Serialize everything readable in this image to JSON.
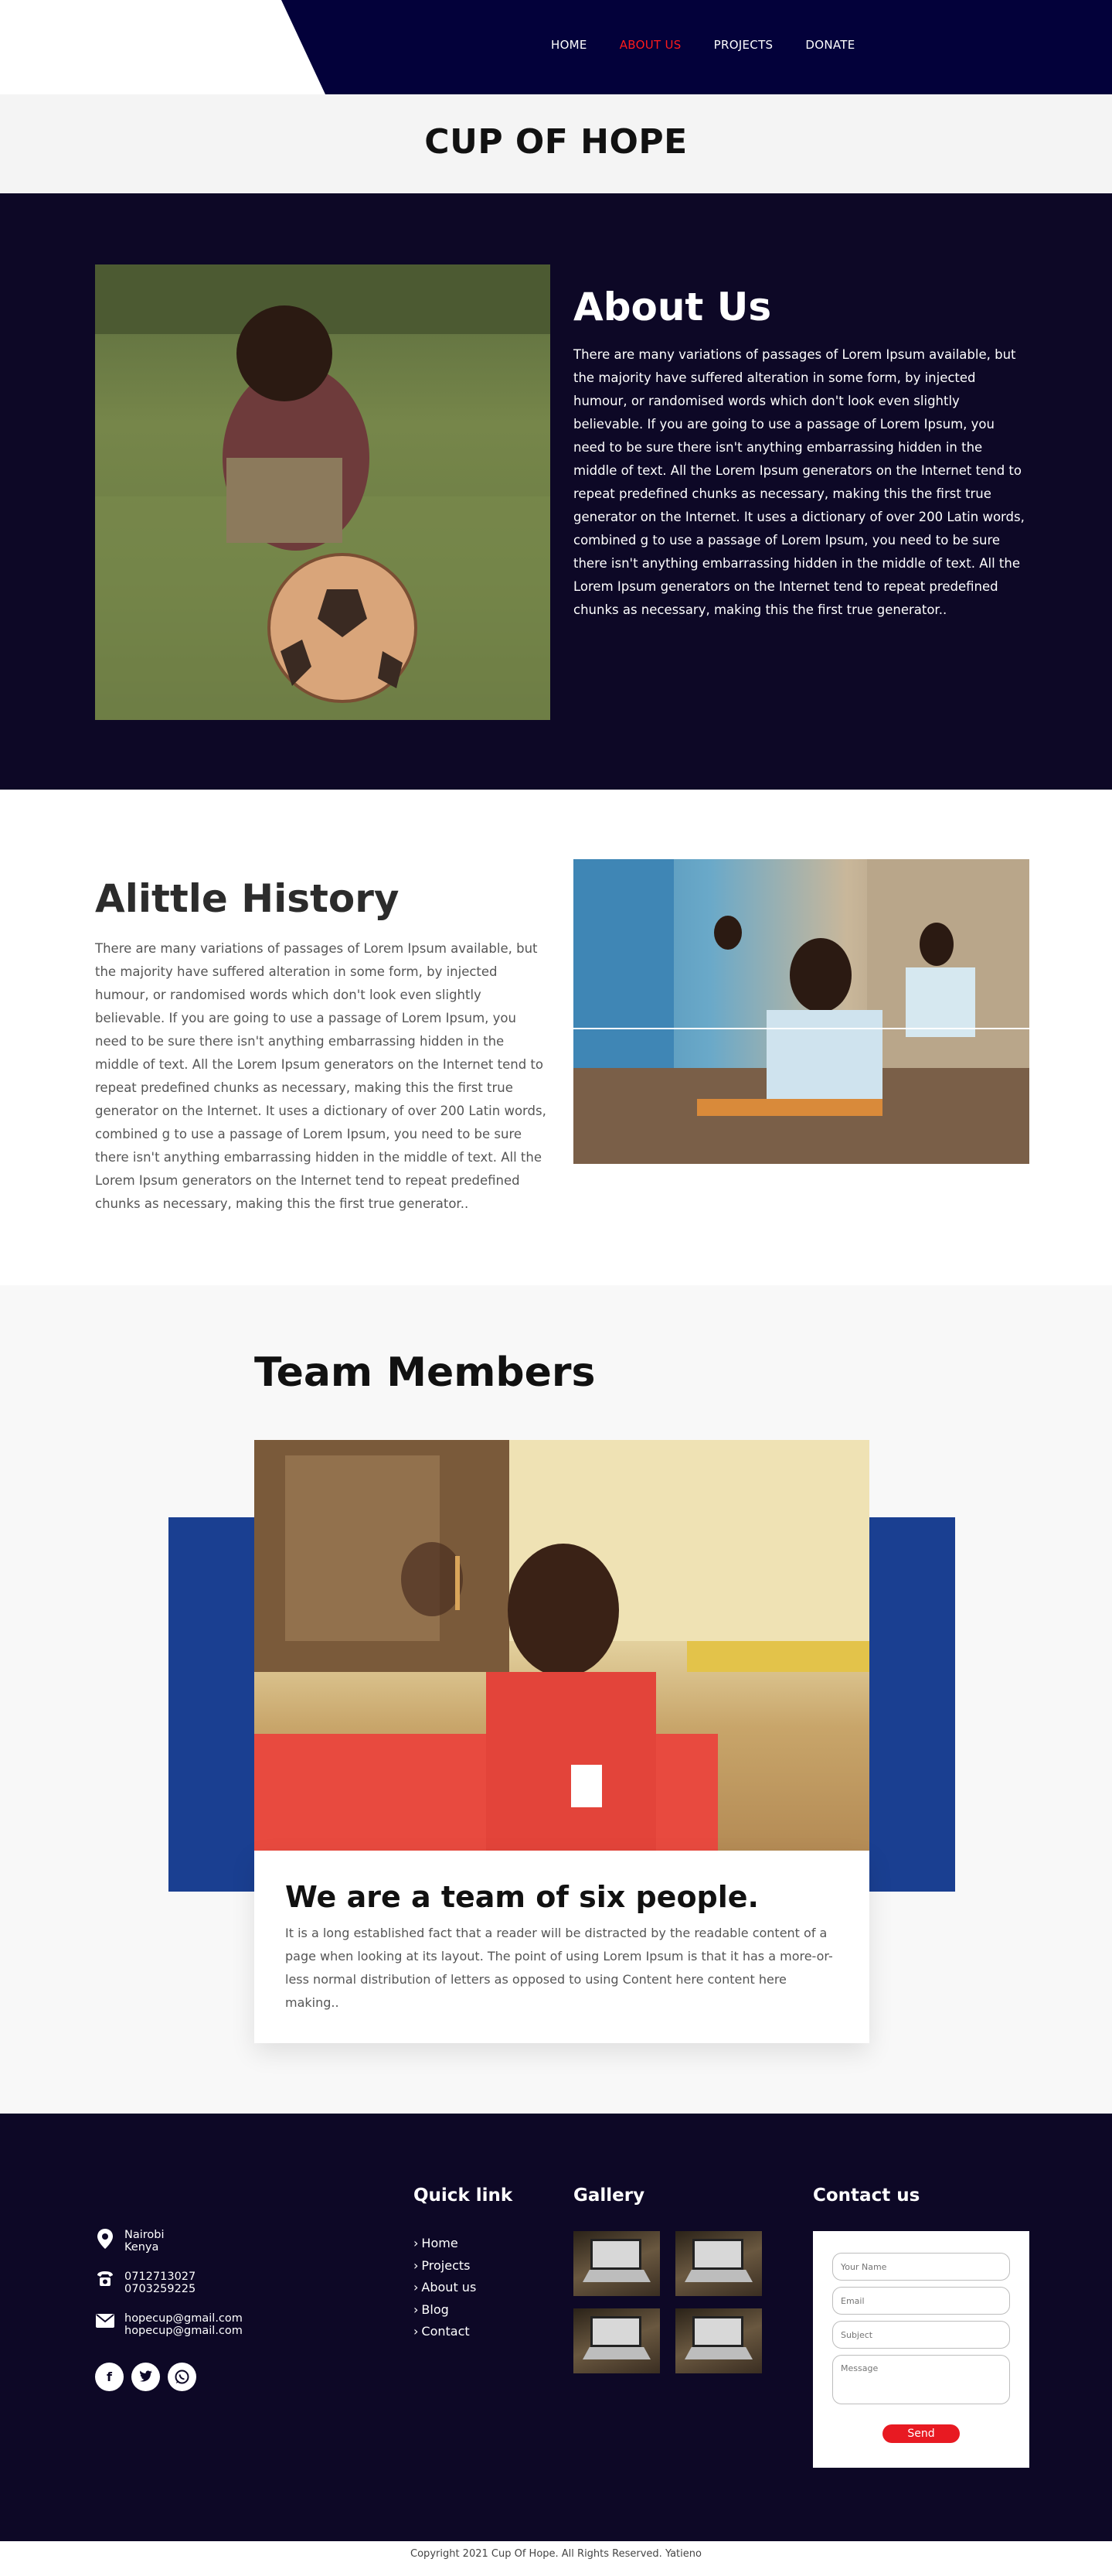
{
  "header": {
    "nav": [
      {
        "label": "HOME",
        "active": false
      },
      {
        "label": "ABOUT US",
        "active": true
      },
      {
        "label": "PROJECTS",
        "active": false
      },
      {
        "label": "DONATE",
        "active": false
      }
    ],
    "site_title": "CUP OF HOPE"
  },
  "about": {
    "title": "About Us",
    "text": "There are many variations of passages of Lorem Ipsum available, but the majority have suffered alteration in some form, by injected humour, or randomised words which don't look even slightly believable. If you are going to use a passage of Lorem Ipsum, you need to be sure there isn't anything embarrassing hidden in the middle of text. All the Lorem Ipsum generators on the Internet tend to repeat predefined chunks as necessary, making this the first true generator on the Internet. It uses a dictionary of over 200 Latin words, combined g to use a passage of Lorem Ipsum, you need to be sure there isn't anything embarrassing hidden in the middle of text. All the Lorem Ipsum generators on the Internet tend to repeat predefined chunks as necessary, making this the first true generator.."
  },
  "history": {
    "title": "Alittle History",
    "text": "There are many variations of passages of Lorem Ipsum available, but the majority have suffered alteration in some form, by injected humour, or randomised words which don't look even slightly believable. If you are going to use a passage of Lorem Ipsum, you need to be sure there isn't anything embarrassing hidden in the middle of text. All the Lorem Ipsum generators on the Internet tend to repeat predefined chunks as necessary, making this the first true generator on the Internet. It uses a dictionary of over 200 Latin words, combined g to use a passage of Lorem Ipsum, you need to be sure there isn't anything embarrassing hidden in the middle of text. All the Lorem Ipsum generators on the Internet tend to repeat predefined chunks as necessary, making this the first true generator.."
  },
  "team": {
    "title": "Team Members",
    "card_title": "We are a team of six people.",
    "card_text": "It is a long established fact that a reader will be distracted by the readable content of a page when looking at its layout. The point of using Lorem Ipsum is that it has a more-or-less normal distribution of letters as opposed to using Content here content here making.."
  },
  "footer": {
    "location": {
      "line1": "Nairobi",
      "line2": "Kenya",
      "icon": "map-pin-icon"
    },
    "phone": {
      "line1": "0712713027",
      "line2": "0703259225",
      "icon": "phone-icon"
    },
    "email": {
      "line1": "hopecup@gmail.com",
      "line2": "hopecup@gmail.com",
      "icon": "envelope-icon"
    },
    "socials": [
      {
        "name": "facebook-icon",
        "glyph": "f"
      },
      {
        "name": "twitter-icon",
        "glyph": "t"
      },
      {
        "name": "whatsapp-icon",
        "glyph": "w"
      }
    ],
    "quick_link_title": "Quick link",
    "quick_links": [
      "Home",
      "Projects",
      "About us",
      "Blog",
      "Contact"
    ],
    "gallery_title": "Gallery",
    "contact_title": "Contact us",
    "form": {
      "name_placeholder": "Your Name",
      "email_placeholder": "Email",
      "subject_placeholder": "Subject",
      "message_placeholder": "Message",
      "send_label": "Send"
    },
    "copyright": "Copyright 2021 Cup Of Hope. All Rights Reserved. Yatieno"
  },
  "colors": {
    "header_navy": "#03013a",
    "dark_section": "#0d0826",
    "accent_red": "#e81a22",
    "team_blue": "#1a3f91"
  }
}
